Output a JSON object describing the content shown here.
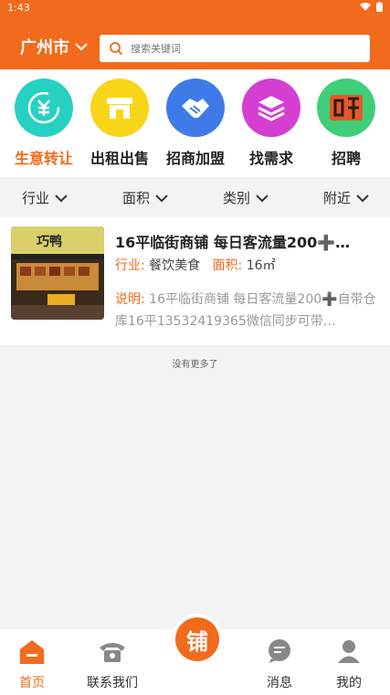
{
  "status": {
    "time": "1:43"
  },
  "header": {
    "city": "广州市",
    "search_placeholder": "搜索关键词"
  },
  "categories": [
    {
      "label": "生意转让",
      "icon": "yuan-exchange-icon",
      "color": "#27d1c1",
      "active": true
    },
    {
      "label": "出租出售",
      "icon": "storefront-icon",
      "color": "#f9d51a",
      "active": false
    },
    {
      "label": "招商加盟",
      "icon": "handshake-icon",
      "color": "#3f7be8",
      "active": false
    },
    {
      "label": "找需求",
      "icon": "layers-icon",
      "color": "#d43fd1",
      "active": false
    },
    {
      "label": "招聘",
      "icon": "recruit-icon",
      "color": "#3fcf79",
      "active": false
    }
  ],
  "filters": [
    "行业",
    "面积",
    "类别",
    "附近"
  ],
  "listing": {
    "title": "16平临街商铺 每日客流量200➕…",
    "industry_key": "行业:",
    "industry_value": "餐饮美食",
    "area_key": "面积:",
    "area_value": "16㎡",
    "desc_key": "说明:",
    "desc_text": "16平临街商铺 每日客流量200➕自带仓库16平13532419365微信同步可带…",
    "thumb_sign": "巧鸭"
  },
  "no_more": "没有更多了",
  "tabbar": {
    "home": "首页",
    "contact": "联系我们",
    "center": "铺",
    "messages": "消息",
    "mine": "我的"
  },
  "colors": {
    "brand": "#f26a1b"
  }
}
